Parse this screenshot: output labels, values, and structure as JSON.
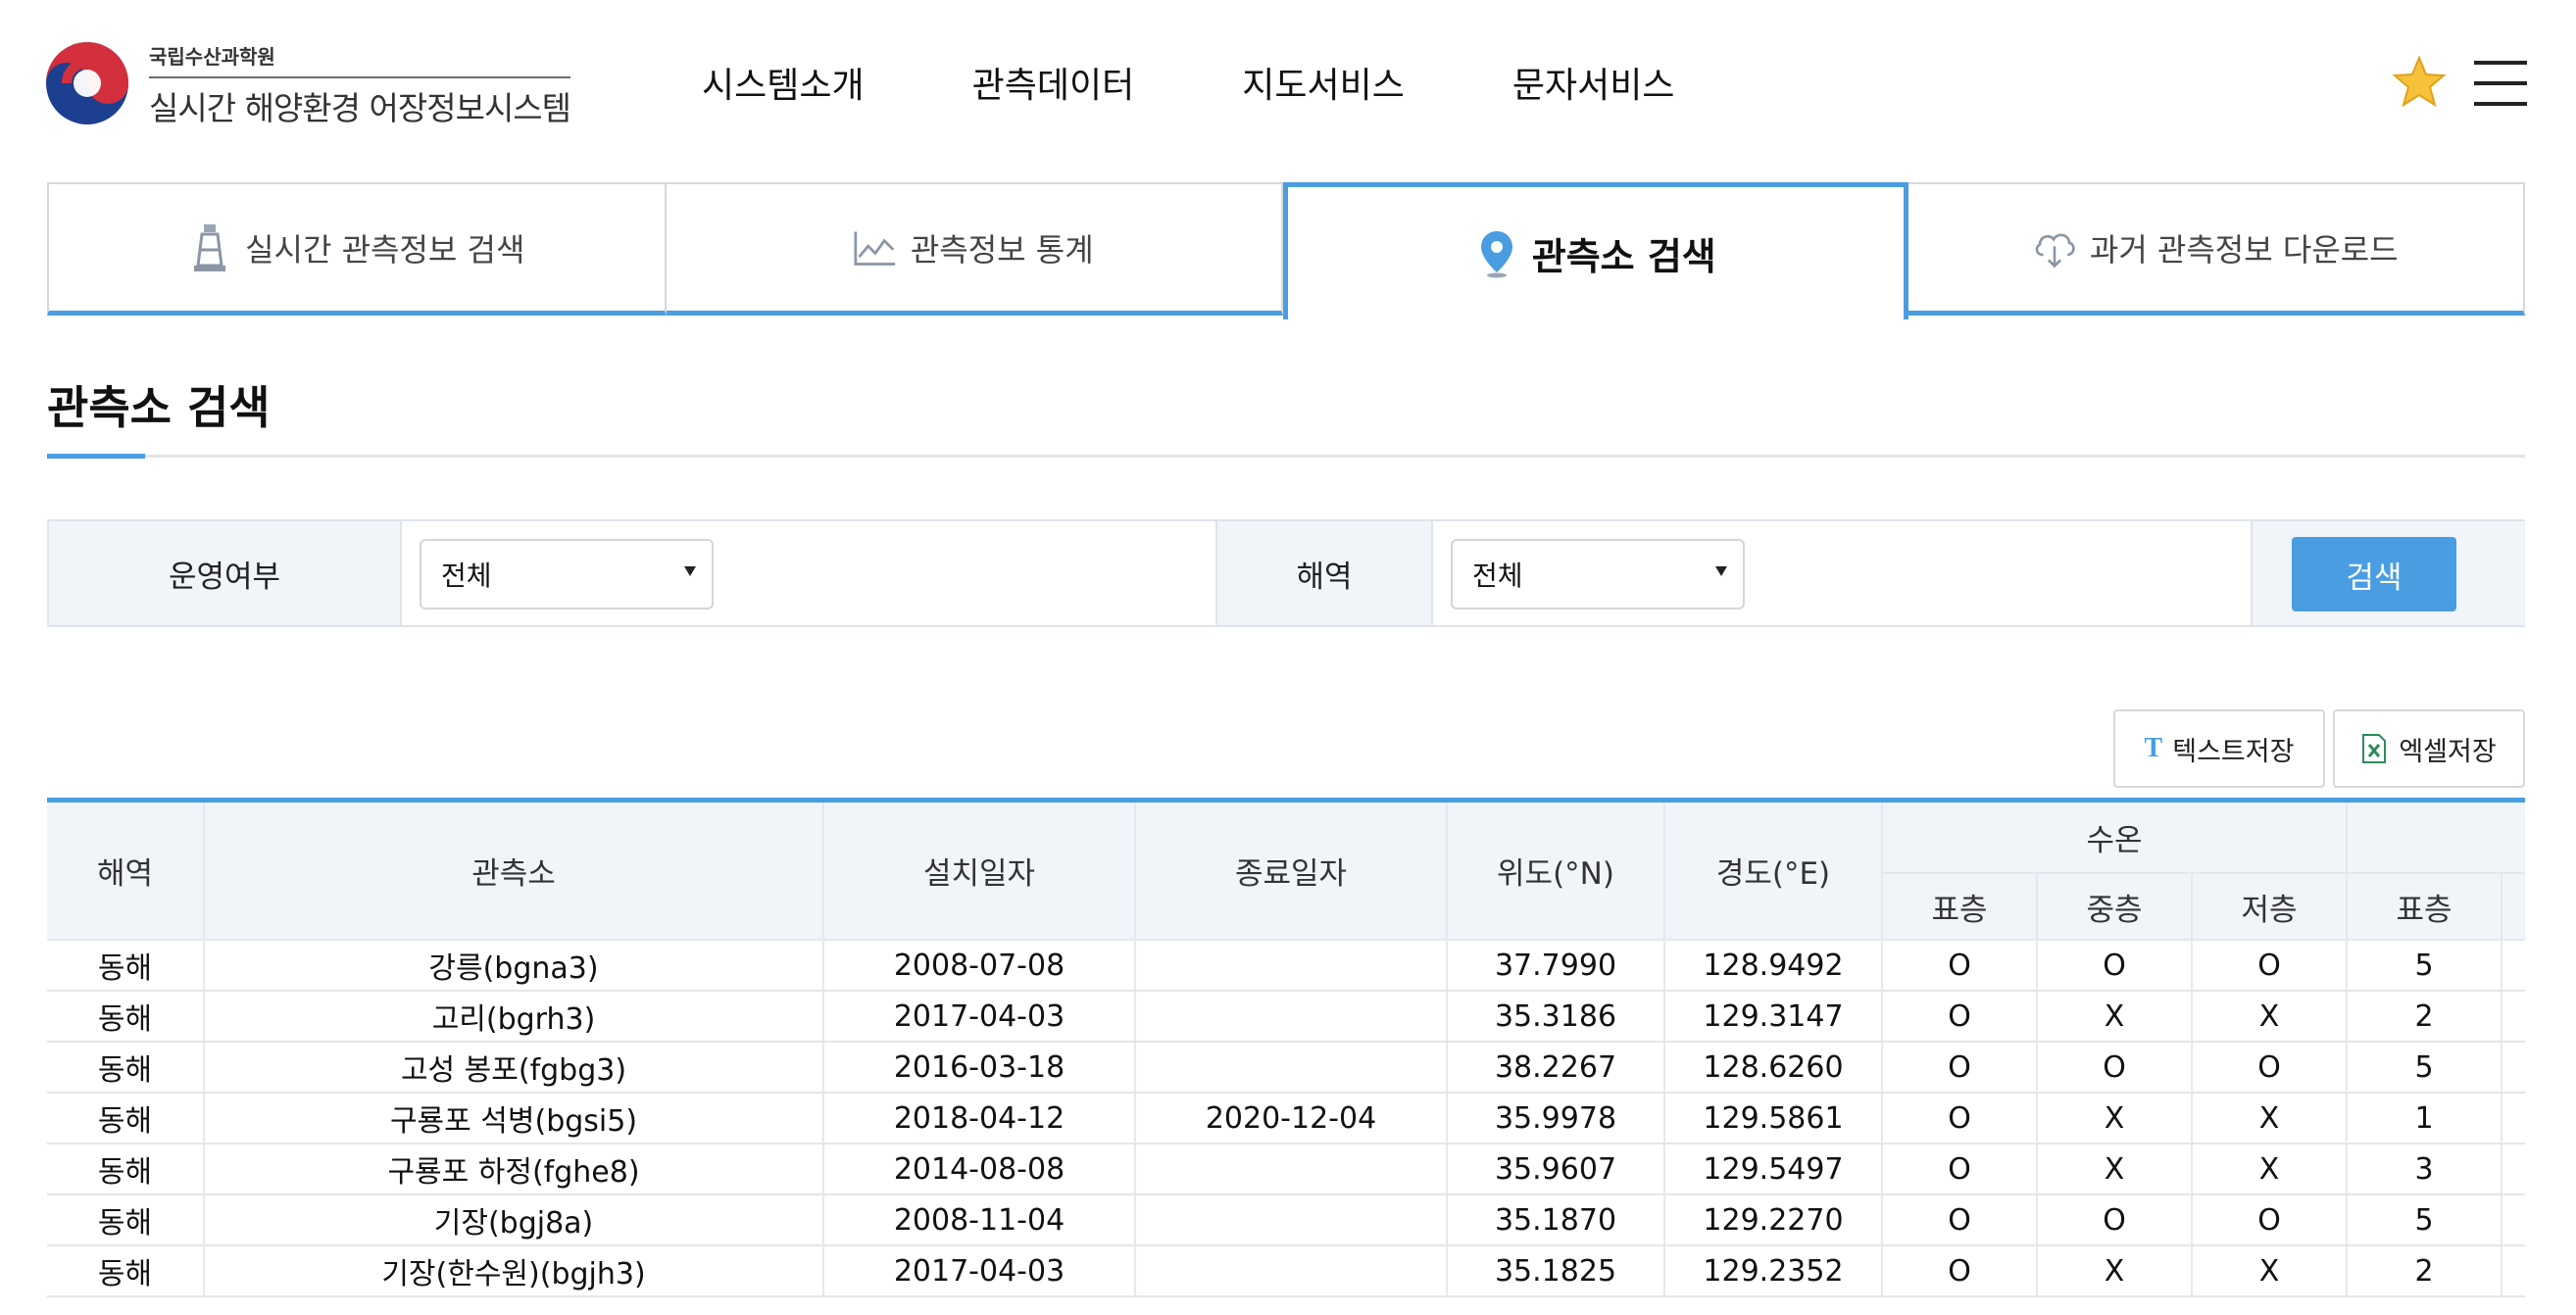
{
  "header": {
    "org_name": "국립수산과학원",
    "site_title": "실시간 해양환경 어장정보시스템",
    "nav": [
      "시스템소개",
      "관측데이터",
      "지도서비스",
      "문자서비스"
    ],
    "star_icon": "star-icon",
    "menu_icon": "hamburger-menu-icon"
  },
  "tabs": [
    {
      "label": "실시간 관측정보 검색",
      "icon": "lighthouse-icon",
      "active": false
    },
    {
      "label": "관측정보 통계",
      "icon": "line-chart-icon",
      "active": false
    },
    {
      "label": "관측소 검색",
      "icon": "map-pin-icon",
      "active": true
    },
    {
      "label": "과거 관측정보 다운로드",
      "icon": "cloud-download-icon",
      "active": false
    }
  ],
  "page": {
    "title": "관측소 검색"
  },
  "search": {
    "status_label": "운영여부",
    "status_value": "전체",
    "region_label": "해역",
    "region_value": "전체",
    "search_button": "검색"
  },
  "actions": {
    "text_save": "텍스트저장",
    "excel_save": "엑셀저장"
  },
  "table": {
    "headers": {
      "region": "해역",
      "station": "관측소",
      "install_date": "설치일자",
      "end_date": "종료일자",
      "lat": "위도(°N)",
      "lon": "경도(°E)",
      "water_temp": "수온",
      "surface": "표층",
      "middle": "중층",
      "bottom": "저층",
      "surface2": "표층"
    },
    "rows": [
      [
        "동해",
        "강릉(bgna3)",
        "2008-07-08",
        "",
        "37.7990",
        "128.9492",
        "O",
        "O",
        "O",
        "5"
      ],
      [
        "동해",
        "고리(bgrh3)",
        "2017-04-03",
        "",
        "35.3186",
        "129.3147",
        "O",
        "X",
        "X",
        "2"
      ],
      [
        "동해",
        "고성 봉포(fgbg3)",
        "2016-03-18",
        "",
        "38.2267",
        "128.6260",
        "O",
        "O",
        "O",
        "5"
      ],
      [
        "동해",
        "구룡포 석병(bgsi5)",
        "2018-04-12",
        "2020-12-04",
        "35.9978",
        "129.5861",
        "O",
        "X",
        "X",
        "1"
      ],
      [
        "동해",
        "구룡포 하정(fghe8)",
        "2014-08-08",
        "",
        "35.9607",
        "129.5497",
        "O",
        "X",
        "X",
        "3"
      ],
      [
        "동해",
        "기장(bgj8a)",
        "2008-11-04",
        "",
        "35.1870",
        "129.2270",
        "O",
        "O",
        "O",
        "5"
      ],
      [
        "동해",
        "기장(한수원)(bgjh3)",
        "2017-04-03",
        "",
        "35.1825",
        "129.2352",
        "O",
        "X",
        "X",
        "2"
      ]
    ]
  }
}
